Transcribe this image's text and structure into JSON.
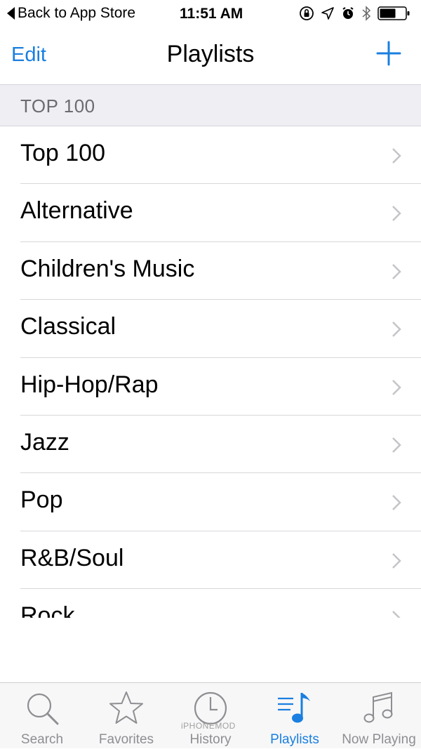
{
  "status_bar": {
    "back_label": "Back to App Store",
    "time": "11:51 AM"
  },
  "nav": {
    "edit_label": "Edit",
    "title": "Playlists"
  },
  "section": {
    "header": "TOP 100"
  },
  "playlists": [
    {
      "label": "Top 100"
    },
    {
      "label": "Alternative"
    },
    {
      "label": "Children's Music"
    },
    {
      "label": "Classical"
    },
    {
      "label": "Hip-Hop/Rap"
    },
    {
      "label": "Jazz"
    },
    {
      "label": "Pop"
    },
    {
      "label": "R&B/Soul"
    },
    {
      "label": "Rock"
    }
  ],
  "tabs": [
    {
      "label": "Search",
      "icon": "magnifier-icon"
    },
    {
      "label": "Favorites",
      "icon": "star-icon"
    },
    {
      "label": "History",
      "icon": "clock-icon"
    },
    {
      "label": "Playlists",
      "icon": "playlist-icon",
      "active": true
    },
    {
      "label": "Now Playing",
      "icon": "music-note-icon"
    }
  ],
  "watermark": "iPHONEMOD",
  "colors": {
    "accent": "#1a7fe0",
    "section_bg": "#eeeef3",
    "inactive_tab": "#8e8e93"
  }
}
